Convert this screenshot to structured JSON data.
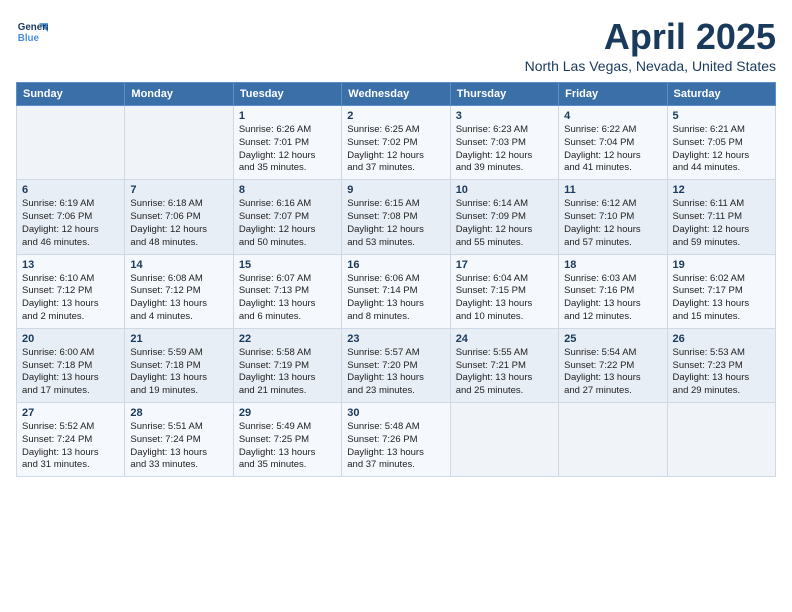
{
  "logo": {
    "line1": "General",
    "line2": "Blue"
  },
  "title": "April 2025",
  "location": "North Las Vegas, Nevada, United States",
  "days_of_week": [
    "Sunday",
    "Monday",
    "Tuesday",
    "Wednesday",
    "Thursday",
    "Friday",
    "Saturday"
  ],
  "weeks": [
    [
      {
        "day": "",
        "info": ""
      },
      {
        "day": "",
        "info": ""
      },
      {
        "day": "1",
        "info": "Sunrise: 6:26 AM\nSunset: 7:01 PM\nDaylight: 12 hours\nand 35 minutes."
      },
      {
        "day": "2",
        "info": "Sunrise: 6:25 AM\nSunset: 7:02 PM\nDaylight: 12 hours\nand 37 minutes."
      },
      {
        "day": "3",
        "info": "Sunrise: 6:23 AM\nSunset: 7:03 PM\nDaylight: 12 hours\nand 39 minutes."
      },
      {
        "day": "4",
        "info": "Sunrise: 6:22 AM\nSunset: 7:04 PM\nDaylight: 12 hours\nand 41 minutes."
      },
      {
        "day": "5",
        "info": "Sunrise: 6:21 AM\nSunset: 7:05 PM\nDaylight: 12 hours\nand 44 minutes."
      }
    ],
    [
      {
        "day": "6",
        "info": "Sunrise: 6:19 AM\nSunset: 7:06 PM\nDaylight: 12 hours\nand 46 minutes."
      },
      {
        "day": "7",
        "info": "Sunrise: 6:18 AM\nSunset: 7:06 PM\nDaylight: 12 hours\nand 48 minutes."
      },
      {
        "day": "8",
        "info": "Sunrise: 6:16 AM\nSunset: 7:07 PM\nDaylight: 12 hours\nand 50 minutes."
      },
      {
        "day": "9",
        "info": "Sunrise: 6:15 AM\nSunset: 7:08 PM\nDaylight: 12 hours\nand 53 minutes."
      },
      {
        "day": "10",
        "info": "Sunrise: 6:14 AM\nSunset: 7:09 PM\nDaylight: 12 hours\nand 55 minutes."
      },
      {
        "day": "11",
        "info": "Sunrise: 6:12 AM\nSunset: 7:10 PM\nDaylight: 12 hours\nand 57 minutes."
      },
      {
        "day": "12",
        "info": "Sunrise: 6:11 AM\nSunset: 7:11 PM\nDaylight: 12 hours\nand 59 minutes."
      }
    ],
    [
      {
        "day": "13",
        "info": "Sunrise: 6:10 AM\nSunset: 7:12 PM\nDaylight: 13 hours\nand 2 minutes."
      },
      {
        "day": "14",
        "info": "Sunrise: 6:08 AM\nSunset: 7:12 PM\nDaylight: 13 hours\nand 4 minutes."
      },
      {
        "day": "15",
        "info": "Sunrise: 6:07 AM\nSunset: 7:13 PM\nDaylight: 13 hours\nand 6 minutes."
      },
      {
        "day": "16",
        "info": "Sunrise: 6:06 AM\nSunset: 7:14 PM\nDaylight: 13 hours\nand 8 minutes."
      },
      {
        "day": "17",
        "info": "Sunrise: 6:04 AM\nSunset: 7:15 PM\nDaylight: 13 hours\nand 10 minutes."
      },
      {
        "day": "18",
        "info": "Sunrise: 6:03 AM\nSunset: 7:16 PM\nDaylight: 13 hours\nand 12 minutes."
      },
      {
        "day": "19",
        "info": "Sunrise: 6:02 AM\nSunset: 7:17 PM\nDaylight: 13 hours\nand 15 minutes."
      }
    ],
    [
      {
        "day": "20",
        "info": "Sunrise: 6:00 AM\nSunset: 7:18 PM\nDaylight: 13 hours\nand 17 minutes."
      },
      {
        "day": "21",
        "info": "Sunrise: 5:59 AM\nSunset: 7:18 PM\nDaylight: 13 hours\nand 19 minutes."
      },
      {
        "day": "22",
        "info": "Sunrise: 5:58 AM\nSunset: 7:19 PM\nDaylight: 13 hours\nand 21 minutes."
      },
      {
        "day": "23",
        "info": "Sunrise: 5:57 AM\nSunset: 7:20 PM\nDaylight: 13 hours\nand 23 minutes."
      },
      {
        "day": "24",
        "info": "Sunrise: 5:55 AM\nSunset: 7:21 PM\nDaylight: 13 hours\nand 25 minutes."
      },
      {
        "day": "25",
        "info": "Sunrise: 5:54 AM\nSunset: 7:22 PM\nDaylight: 13 hours\nand 27 minutes."
      },
      {
        "day": "26",
        "info": "Sunrise: 5:53 AM\nSunset: 7:23 PM\nDaylight: 13 hours\nand 29 minutes."
      }
    ],
    [
      {
        "day": "27",
        "info": "Sunrise: 5:52 AM\nSunset: 7:24 PM\nDaylight: 13 hours\nand 31 minutes."
      },
      {
        "day": "28",
        "info": "Sunrise: 5:51 AM\nSunset: 7:24 PM\nDaylight: 13 hours\nand 33 minutes."
      },
      {
        "day": "29",
        "info": "Sunrise: 5:49 AM\nSunset: 7:25 PM\nDaylight: 13 hours\nand 35 minutes."
      },
      {
        "day": "30",
        "info": "Sunrise: 5:48 AM\nSunset: 7:26 PM\nDaylight: 13 hours\nand 37 minutes."
      },
      {
        "day": "",
        "info": ""
      },
      {
        "day": "",
        "info": ""
      },
      {
        "day": "",
        "info": ""
      }
    ]
  ]
}
